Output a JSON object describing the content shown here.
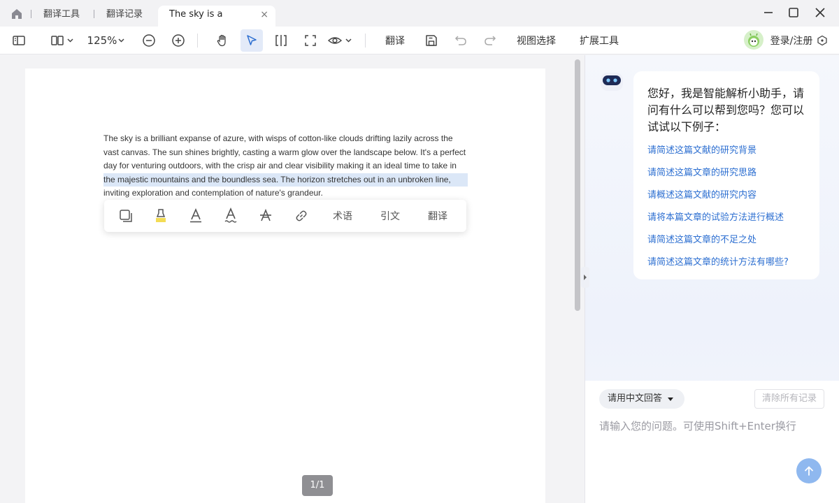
{
  "tabs": [
    {
      "label": "翻译工具"
    },
    {
      "label": "翻译记录"
    },
    {
      "label": "The sky is a brillian...",
      "close": "×"
    }
  ],
  "toolbar": {
    "zoom": "125%",
    "translate": "翻译",
    "view_select": "视图选择",
    "extensions": "扩展工具",
    "login": "登录/注册"
  },
  "document": {
    "line1": "The sky is a brilliant expanse of azure, with wisps of cotton-like clouds drifting lazily across the",
    "line2": "vast canvas. The sun shines brightly, casting a warm glow over the landscape below. It's a perfect",
    "line3": "day for venturing outdoors, with the crisp air and clear visibility making it an ideal time to take in",
    "line4": "the majestic mountains and the boundless sea. The horizon stretches out in an unbroken line,",
    "line5": "inviting exploration and contemplation of nature's grandeur.",
    "page_indicator": "1/1"
  },
  "selection_toolbar": {
    "term": "术语",
    "cite": "引文",
    "translate": "翻译"
  },
  "assistant": {
    "greeting": "您好，我是智能解析小助手，请问有什么可以帮到您吗？您可以试试以下例子：",
    "suggestions": [
      "请简述这篇文献的研究背景",
      "请简述这篇文章的研究思路",
      "请概述这篇文献的研究内容",
      "请将本篇文章的试验方法进行概述",
      "请简述这篇文章的不足之处",
      "请简述这篇文章的统计方法有哪些?"
    ],
    "language": "请用中文回答",
    "clear": "清除所有记录",
    "input_placeholder": "请输入您的问题。可使用Shift+Enter换行"
  }
}
